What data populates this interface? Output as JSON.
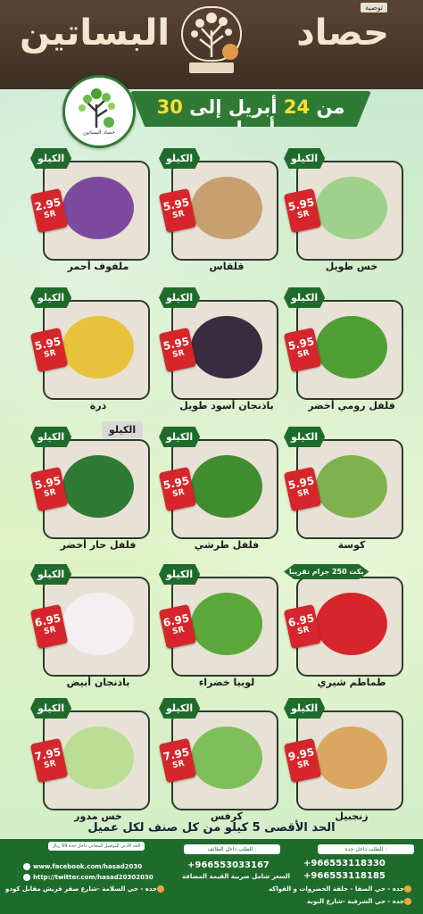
{
  "header": {
    "brand_left": "البساتين",
    "brand_right": "حصاد",
    "tag": "توصية",
    "logo_sub": "حصاد البساتين"
  },
  "promo": {
    "date_prefix": "من",
    "date_start": "24",
    "date_mid": "أبريل إلى",
    "date_end": "30",
    "date_suffix": "أبريل"
  },
  "products": [
    {
      "name": "خس طويل",
      "unit": "الكيلو",
      "price": "5.95",
      "currency": "SR"
    },
    {
      "name": "قلقاس",
      "unit": "الكيلو",
      "price": "5.95",
      "currency": "SR"
    },
    {
      "name": "ملفوف أحمر",
      "unit": "الكيلو",
      "price": "2.95",
      "currency": "SR"
    },
    {
      "name": "فلفل رومي أخضر",
      "unit": "الكيلو",
      "price": "5.95",
      "currency": "SR"
    },
    {
      "name": "باذنجان أسود طويل",
      "unit": "الكيلو",
      "price": "5.95",
      "currency": "SR"
    },
    {
      "name": "ذرة",
      "unit": "الكيلو",
      "price": "5.95",
      "currency": "SR"
    },
    {
      "name": "كوسة",
      "unit": "الكيلو",
      "price": "5.95",
      "currency": "SR"
    },
    {
      "name": "فلفل طرشي",
      "unit": "الكيلو",
      "price": "5.95",
      "currency": "SR"
    },
    {
      "name": "فلفل حار أخضر",
      "unit": "الكيلو",
      "price": "5.95",
      "currency": "SR"
    },
    {
      "name": "طماطم شيري",
      "unit": "بكت 250 جرام تقريبا",
      "price": "6.95",
      "currency": "SR"
    },
    {
      "name": "لوبيا خضراء",
      "unit": "الكيلو",
      "price": "6.95",
      "currency": "SR"
    },
    {
      "name": "باذنجان أبيض",
      "unit": "الكيلو",
      "price": "6.95",
      "currency": "SR"
    },
    {
      "name": "زنجبيل",
      "unit": "الكيلو",
      "price": "9.95",
      "currency": "SR"
    },
    {
      "name": "كرفس",
      "unit": "الكيلو",
      "price": "7.95",
      "currency": "SR"
    },
    {
      "name": "خس مدور",
      "unit": "الكيلو",
      "price": "7.95",
      "currency": "SR"
    }
  ],
  "extra_kilo_label": "الكيلو",
  "limit_note": "الحد الأقصى 5 كيلو من كل صنف لكل عميل",
  "footer": {
    "jeddah_label": "للطلب داخل جده :",
    "taif_label": "للطلب داخل الطائف :",
    "min_order": "الحد الأدنى للتوصيل المجاني داخل جده 99 ريال",
    "phone_jeddah_1": "+966553118330",
    "phone_jeddah_2": "+966553118185",
    "phone_taif": "+966553033167",
    "vat_note": "السعر شامل ضريبة القيمة المضافة",
    "facebook": "www.facebook.com/hasad2030",
    "twitter": "http://twitter.com/hasad20302030",
    "branch_1": "جده - حي الصفا - حلقة الخضروات و الفواكه",
    "branch_2": "جده - حي السلامة -شارع صقر قريش مقابل كودو",
    "branch_3": "جده - حي الشرفية -شارع النوبة"
  },
  "colors": {
    "brand_green": "#1f6b2c",
    "price_red": "#d6262b",
    "header_brown": "#3d2e23",
    "accent_yellow": "#ffde2e"
  }
}
